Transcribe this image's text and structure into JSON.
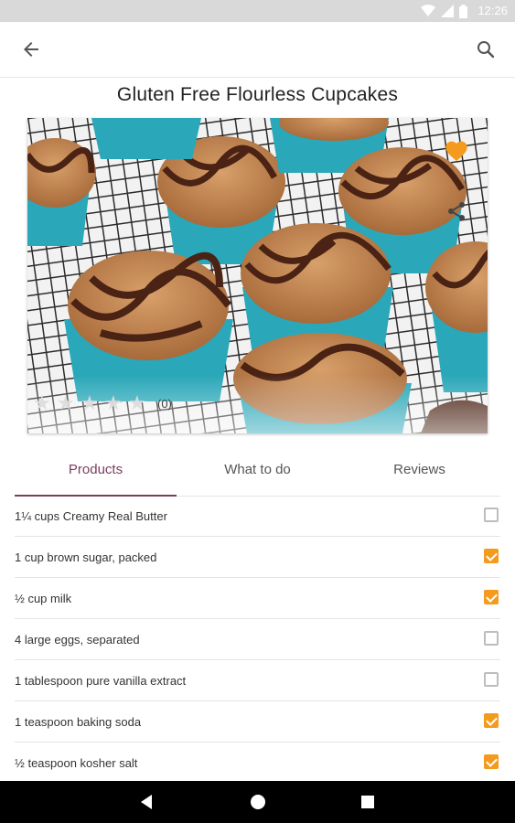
{
  "status_bar": {
    "time": "12:26",
    "icons": [
      "wifi-icon",
      "signal-icon",
      "battery-icon"
    ]
  },
  "toolbar": {
    "back_icon": "arrow-left-icon",
    "search_icon": "search-icon"
  },
  "recipe": {
    "title": "Gluten Free Flourless Cupcakes",
    "rating_count": "(0)",
    "stars": [
      0,
      0,
      0,
      0,
      0
    ]
  },
  "tabs": [
    {
      "label": "Products",
      "active": true
    },
    {
      "label": "What to do",
      "active": false
    },
    {
      "label": "Reviews",
      "active": false
    }
  ],
  "ingredients": [
    {
      "label": "1¼ cups Creamy Real Butter",
      "checked": false
    },
    {
      "label": "1 cup brown sugar, packed",
      "checked": true
    },
    {
      "label": "½ cup milk",
      "checked": true
    },
    {
      "label": "4 large eggs, separated",
      "checked": false
    },
    {
      "label": "1 tablespoon pure vanilla extract",
      "checked": false
    },
    {
      "label": "1 teaspoon baking soda",
      "checked": true
    },
    {
      "label": "½ teaspoon kosher salt",
      "checked": true
    }
  ],
  "colors": {
    "accent": "#7b3d5e",
    "checkbox": "#f49a1c",
    "favorite": "#f49a1c"
  }
}
